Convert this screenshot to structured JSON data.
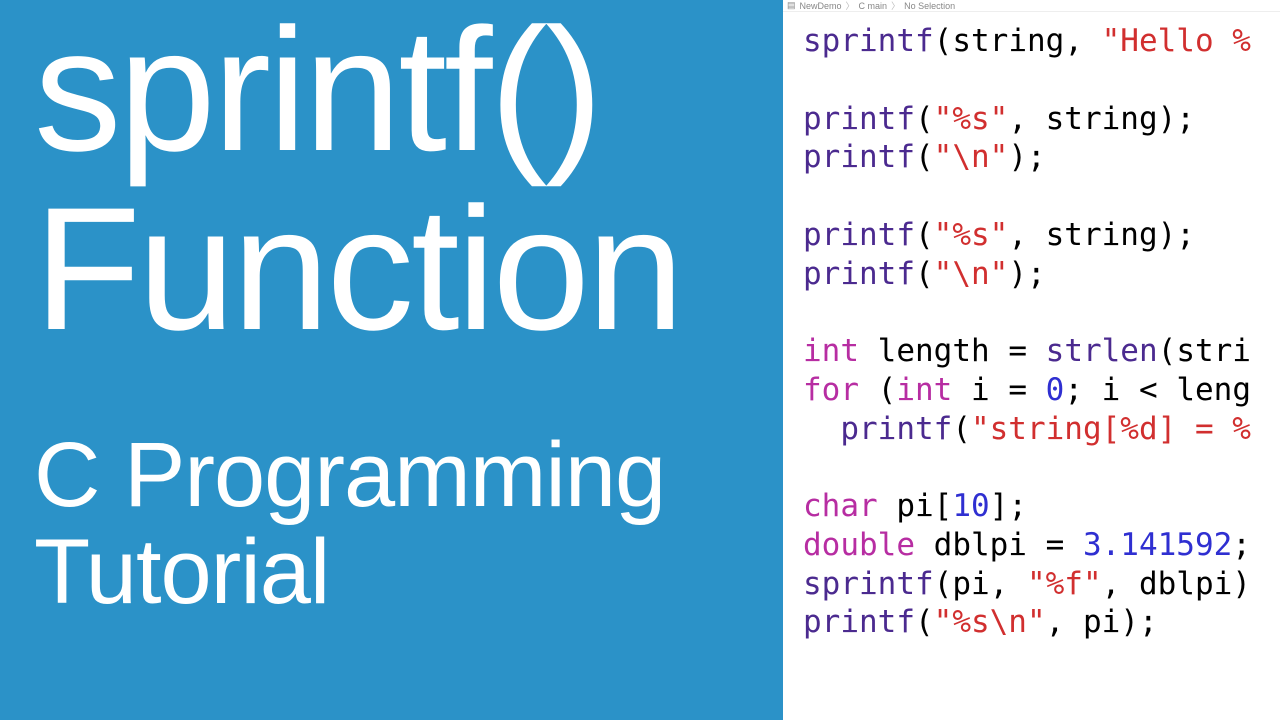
{
  "left": {
    "title_line1": "sprintf()",
    "title_line2": "Function",
    "subtitle_line1": "C Programming",
    "subtitle_line2": "Tutorial"
  },
  "breadcrumb": {
    "item1": "NewDemo",
    "item2": "C  main",
    "item3": "No Selection"
  },
  "code": {
    "tokens": {
      "sprintf": "sprintf",
      "printf": "printf",
      "strlen": "strlen",
      "int": "int",
      "for": "for",
      "char": "char",
      "double": "double",
      "string": "string",
      "stri": "stri",
      "length": "length",
      "leng": "leng",
      "i": "i",
      "pi": "pi",
      "dblpi": "dblpi",
      "hello_fmt": "\"Hello %",
      "pct_s": "\"%s\"",
      "nl": "\"\\n\"",
      "string_idx_fmt": "\"string[%d] = %",
      "pct_f": "\"%f\"",
      "pct_s_nl": "\"%s\\n\"",
      "zero": "0",
      "ten": "10",
      "pi_val": "3.141592"
    }
  }
}
